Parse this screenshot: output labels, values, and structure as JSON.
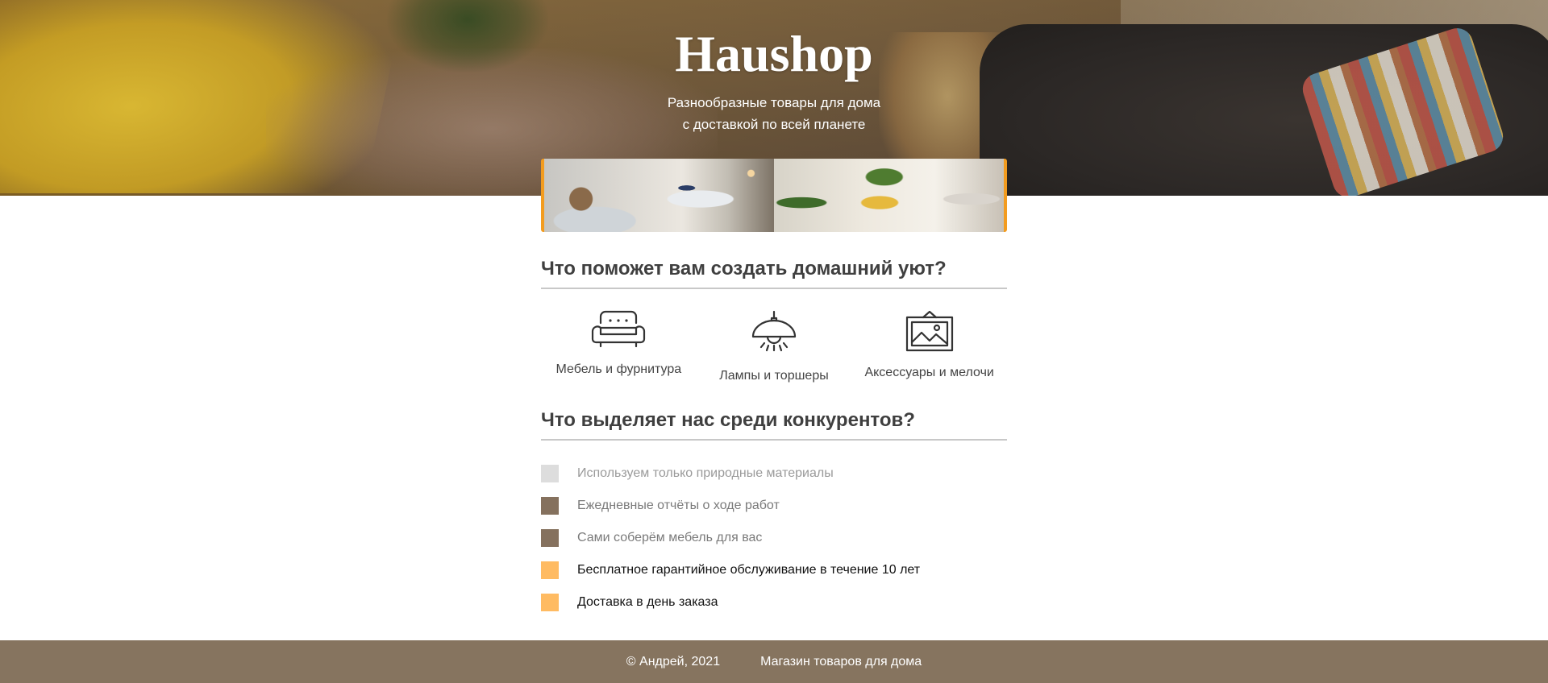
{
  "header": {
    "title": "Haushop",
    "subtitle_line1": "Разнообразные товары для дома",
    "subtitle_line2": "с доставкой по всей планете"
  },
  "colors": {
    "accent": "#f39c1f",
    "footer_bg": "#86745f",
    "marker_gray": "#dddddd",
    "marker_brown": "#85715e",
    "marker_orange": "#ffbb62"
  },
  "categories_section": {
    "title": "Что поможет вам создать домашний уют?",
    "items": [
      {
        "icon": "sofa-icon",
        "label": "Мебель и фурнитура"
      },
      {
        "icon": "lamp-icon",
        "label": "Лампы и торшеры"
      },
      {
        "icon": "picture-frame-icon",
        "label": "Аксессуары и мелочи"
      }
    ]
  },
  "features_section": {
    "title": "Что выделяет нас среди конкурентов?",
    "items": [
      {
        "text": "Используем только природные материалы",
        "marker_color": "#dddddd",
        "text_color": "#9a9a9a"
      },
      {
        "text": "Ежедневные отчёты о ходе работ",
        "marker_color": "#85715e",
        "text_color": "#7a7a7a"
      },
      {
        "text": "Сами соберём мебель для вас",
        "marker_color": "#85715e",
        "text_color": "#7a7a7a"
      },
      {
        "text": "Бесплатное гарантийное обслуживание в течение 10 лет",
        "marker_color": "#ffbb62",
        "text_color": "#111111"
      },
      {
        "text": "Доставка в день заказа",
        "marker_color": "#ffbb62",
        "text_color": "#111111"
      }
    ]
  },
  "footer": {
    "copyright": "© Андрей, 2021",
    "tagline": "Магазин товаров для дома"
  }
}
